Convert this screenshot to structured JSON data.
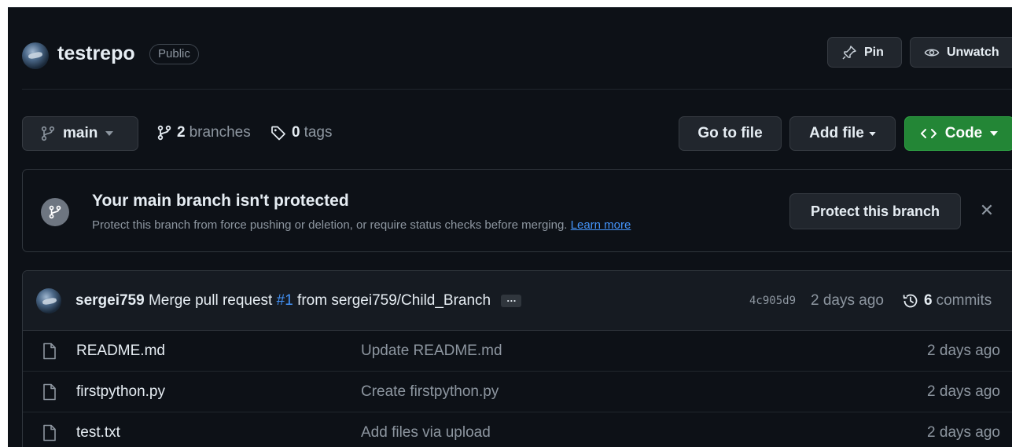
{
  "repo": {
    "name": "testrepo",
    "visibility": "Public",
    "pin_label": "Pin",
    "unwatch_label": "Unwatch"
  },
  "branch_bar": {
    "current_branch": "main",
    "branches_count": "2",
    "branches_label": "branches",
    "tags_count": "0",
    "tags_label": "tags",
    "go_to_file": "Go to file",
    "add_file": "Add file",
    "code": "Code"
  },
  "protection_banner": {
    "title": "Your main branch isn't protected",
    "description": "Protect this branch from force pushing or deletion, or require status checks before merging.",
    "learn_more": "Learn more",
    "button": "Protect this branch"
  },
  "latest_commit": {
    "author": "sergei759",
    "message_prefix": "Merge pull request",
    "pr_number": "#1",
    "message_suffix": "from sergei759/Child_Branch",
    "sha": "4c905d9",
    "time": "2 days ago",
    "commit_count": "6",
    "commits_label": "commits"
  },
  "files": [
    {
      "name": "README.md",
      "commit": "Update README.md",
      "time": "2 days ago"
    },
    {
      "name": "firstpython.py",
      "commit": "Create firstpython.py",
      "time": "2 days ago"
    },
    {
      "name": "test.txt",
      "commit": "Add files via upload",
      "time": "2 days ago"
    }
  ],
  "colors": {
    "background": "#0d1117",
    "accent_green": "#238636",
    "link_blue": "#4493f8",
    "muted_text": "#8d96a0"
  }
}
